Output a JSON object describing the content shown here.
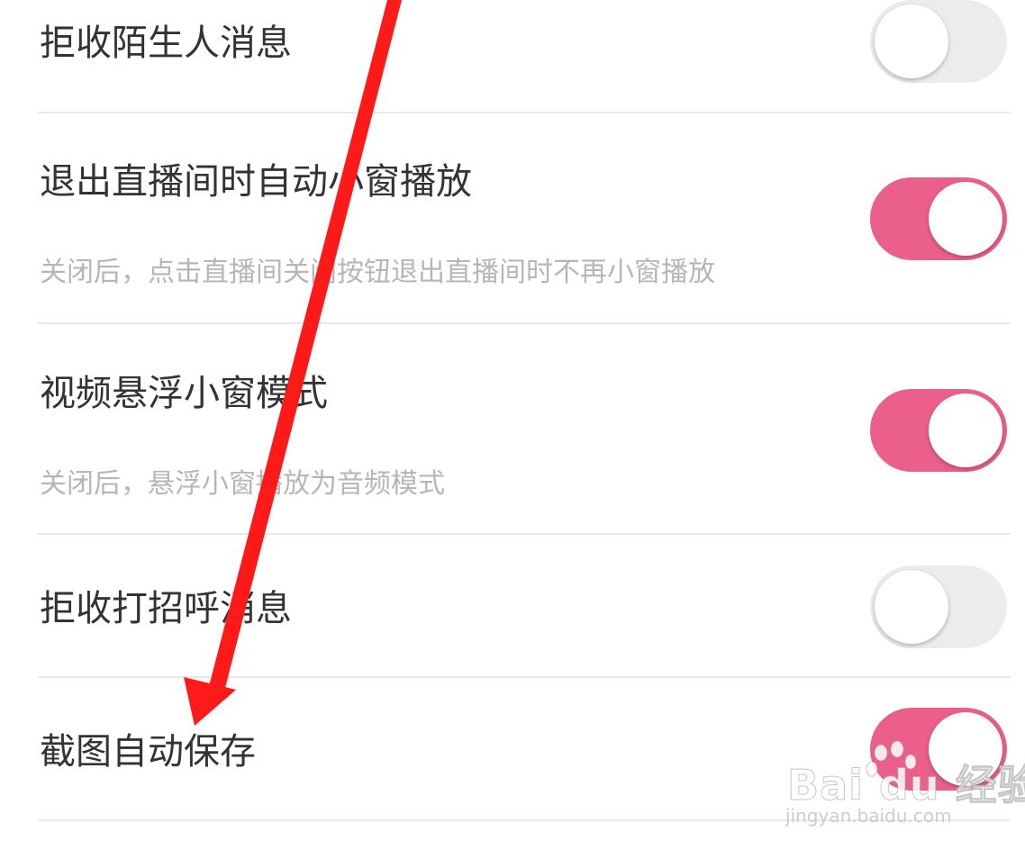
{
  "settings": {
    "items": [
      {
        "title": "拒收陌生人消息",
        "subtitle": "",
        "enabled": false
      },
      {
        "title": "退出直播间时自动小窗播放",
        "subtitle": "关闭后，点击直播间关闭按钮退出直播间时不再小窗播放",
        "enabled": true
      },
      {
        "title": "视频悬浮小窗模式",
        "subtitle": "关闭后，悬浮小窗播放为音频模式",
        "enabled": true
      },
      {
        "title": "拒收打招呼消息",
        "subtitle": "",
        "enabled": false
      },
      {
        "title": "截图自动保存",
        "subtitle": "",
        "enabled": true
      }
    ]
  },
  "watermark": {
    "brand": "Bai du 经验",
    "url": "jingyan.baidu.com"
  },
  "colors": {
    "toggle_on": "#ea608a",
    "toggle_off": "#ececec",
    "annotation_arrow": "#ff1a1a"
  },
  "icons": {
    "annotation": "red-arrow-icon",
    "watermark_logo": "baidu-paw-icon"
  }
}
